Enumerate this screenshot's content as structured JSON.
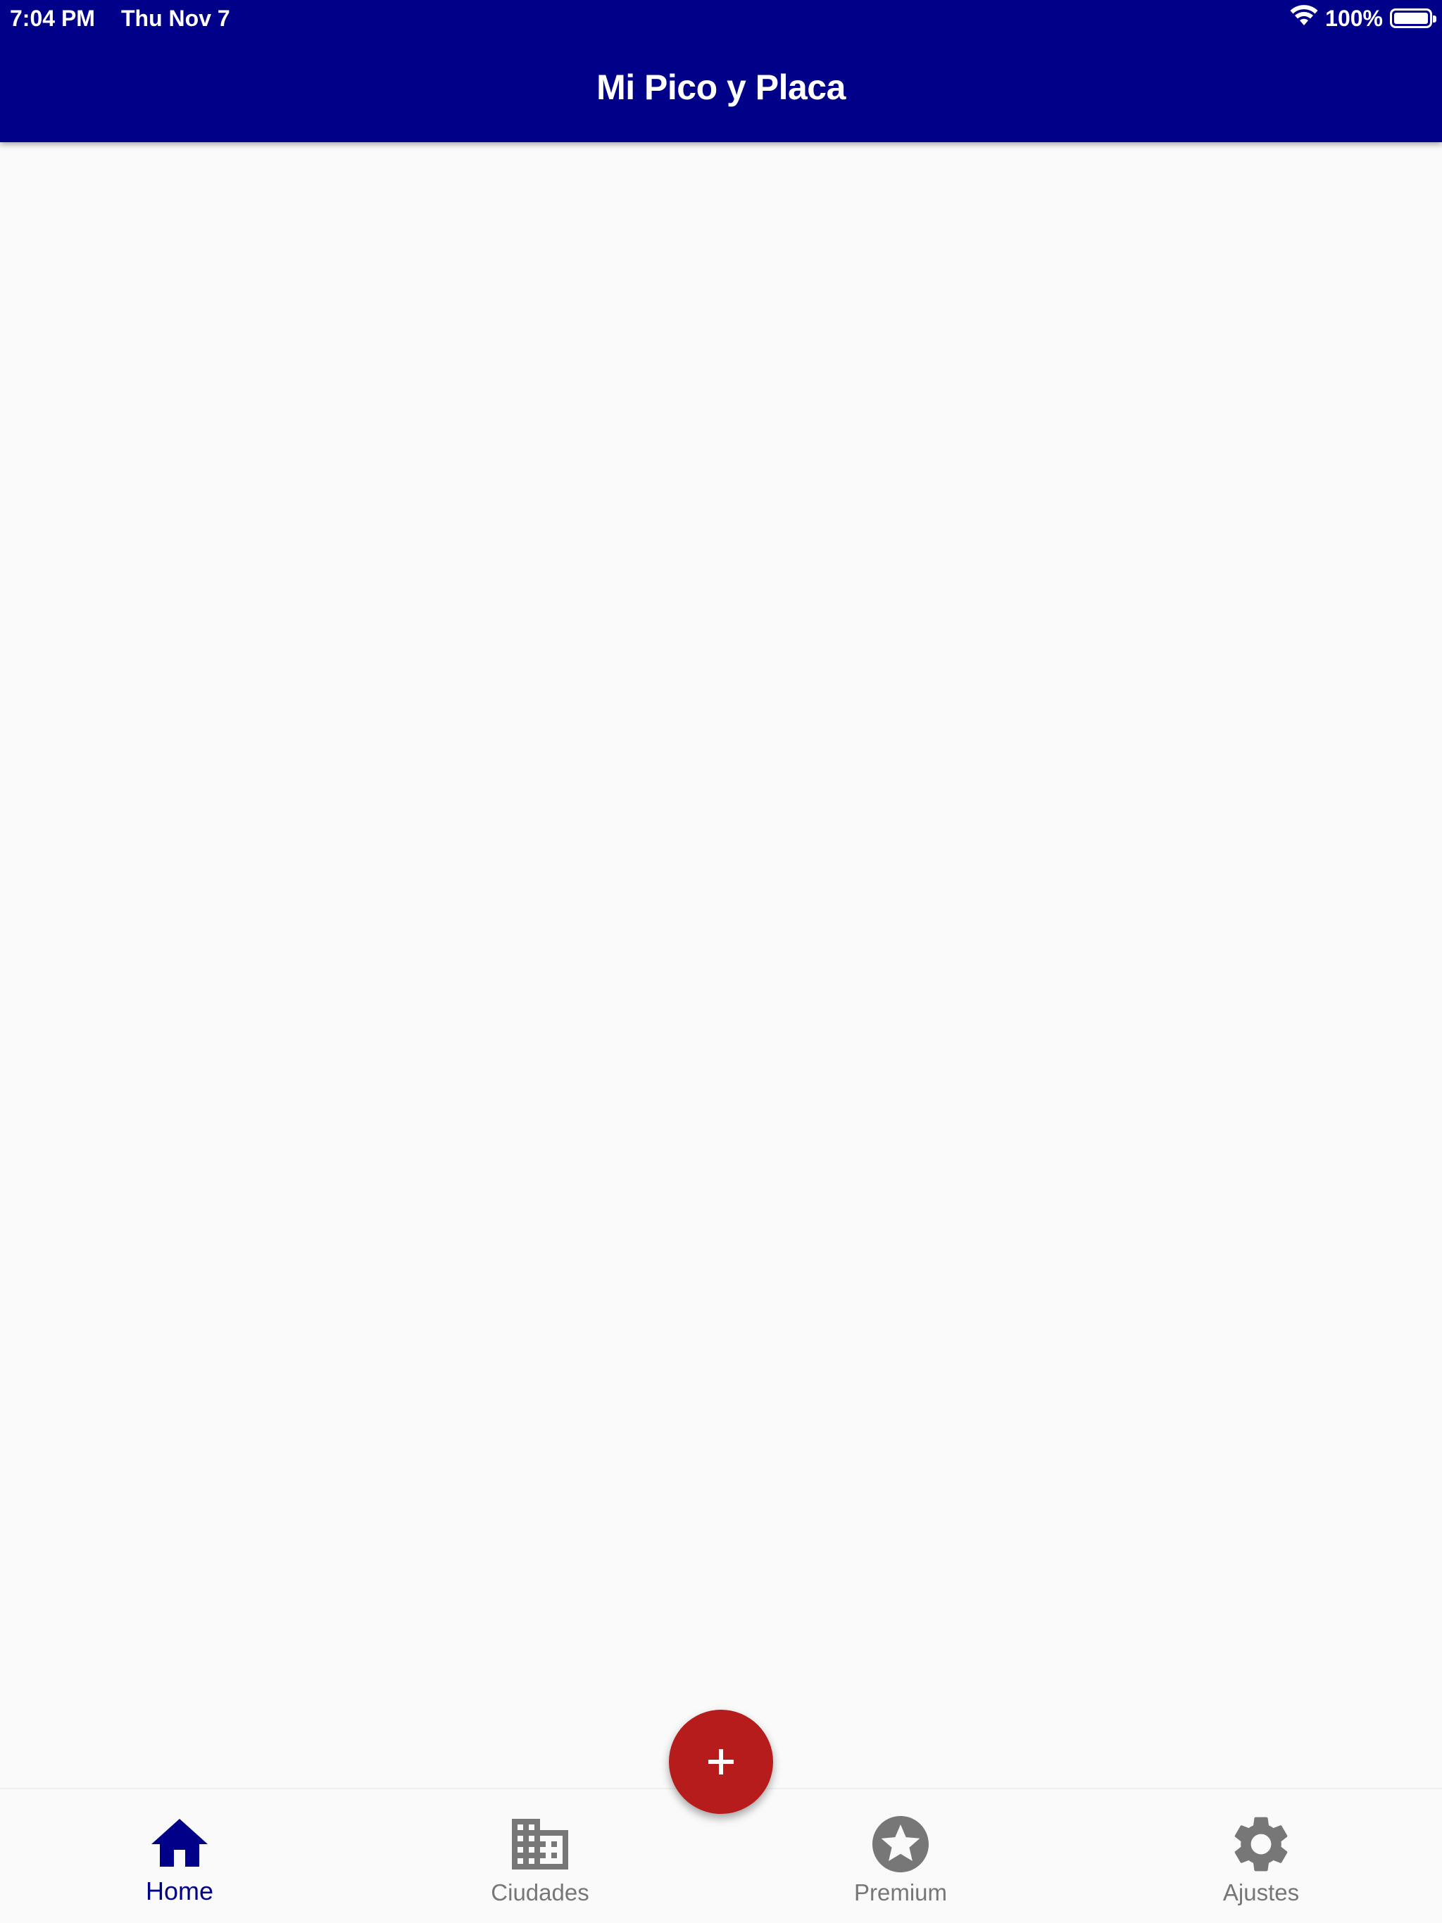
{
  "status_bar": {
    "time": "7:04 PM",
    "date": "Thu Nov 7",
    "battery_percent": "100%",
    "battery_level": 1.0
  },
  "app_bar": {
    "title": "Mi Pico y Placa"
  },
  "fab": {
    "icon": "plus-icon"
  },
  "bottom_nav": {
    "items": [
      {
        "label": "Home",
        "icon": "home-icon",
        "active": true
      },
      {
        "label": "Ciudades",
        "icon": "building-icon",
        "active": false
      },
      {
        "label": "Premium",
        "icon": "star-circle-icon",
        "active": false
      },
      {
        "label": "Ajustes",
        "icon": "gear-icon",
        "active": false
      }
    ]
  },
  "colors": {
    "primary": "#000088",
    "accent": "#b71c1c",
    "background": "#fafafa",
    "inactive": "#777777"
  }
}
